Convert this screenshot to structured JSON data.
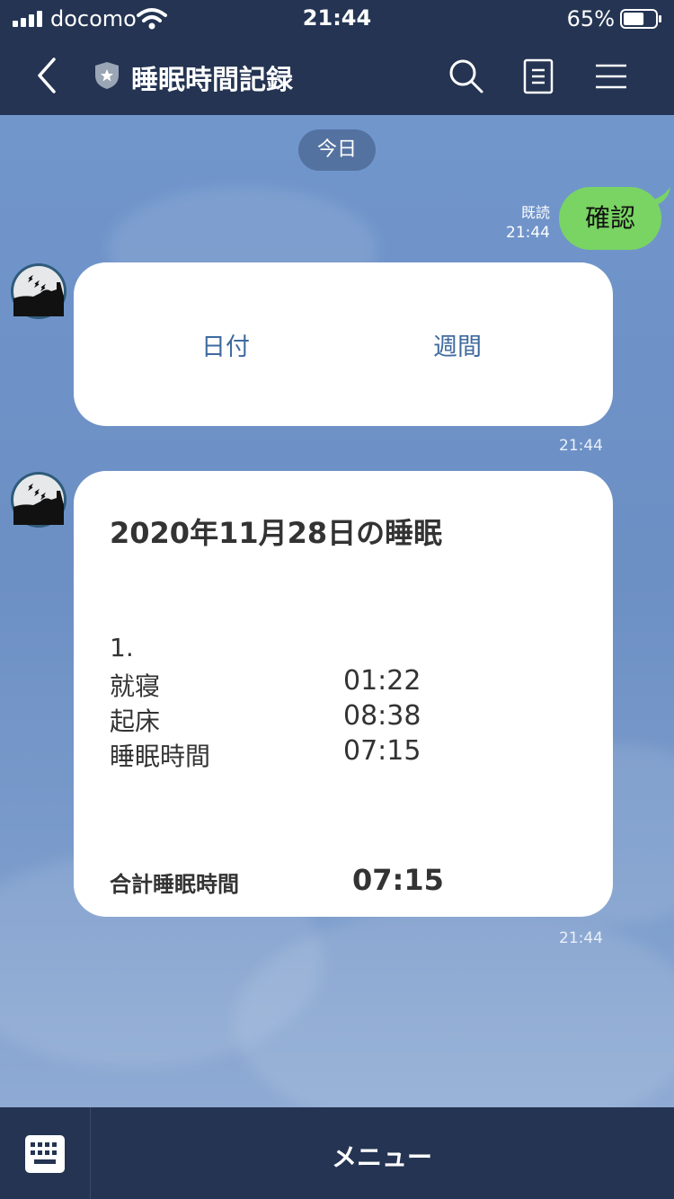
{
  "status_bar": {
    "carrier": "docomo",
    "time": "21:44",
    "battery_percent": "65%",
    "battery_level": 0.65
  },
  "header": {
    "title": "睡眠時間記録"
  },
  "chat": {
    "date_label": "今日",
    "sent": {
      "text": "確認",
      "read_label": "既読",
      "time": "21:44"
    },
    "options_card": {
      "options": [
        "日付",
        "週間"
      ],
      "time": "21:44"
    },
    "report_card": {
      "title": "2020年11月28日の睡眠",
      "record_number": "1.",
      "rows": [
        {
          "label": "就寝",
          "value": "01:22"
        },
        {
          "label": "起床",
          "value": "08:38"
        },
        {
          "label": "睡眠時間",
          "value": "07:15"
        }
      ],
      "total_label": "合計睡眠時間",
      "total_value": "07:15",
      "time": "21:44"
    }
  },
  "bottom_bar": {
    "menu_label": "メニュー"
  },
  "colors": {
    "header_bg": "#243452",
    "sent_bubble": "#79d463",
    "option_text": "#3f6a9e"
  }
}
